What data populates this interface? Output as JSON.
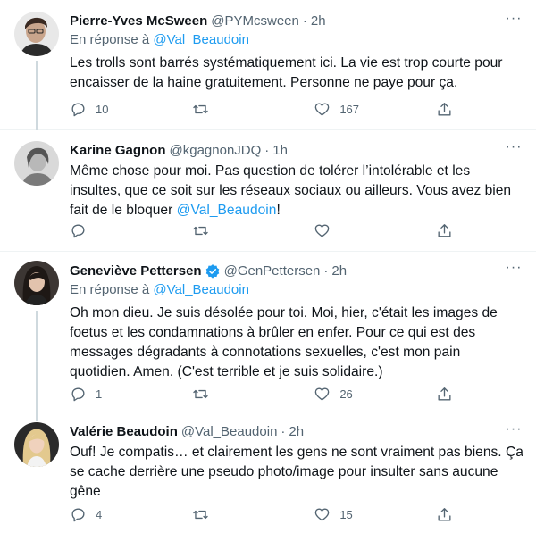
{
  "tweets": [
    {
      "name": "Pierre-Yves McSween",
      "handle": "@PYMcsween",
      "separator": "·",
      "time": "2h",
      "reply_prefix": "En réponse à",
      "reply_handle": "@Val_Beaudoin",
      "text": "Les trolls sont barrés systématiquement ici. La vie est trop courte pour encaisser de la haine gratuitement. Personne ne paye pour ça.",
      "replies": "10",
      "retweets": "",
      "likes": "167",
      "more": "···"
    },
    {
      "name": "Karine Gagnon",
      "handle": "@kgagnonJDQ",
      "separator": "·",
      "time": "1h",
      "text_before": "Même chose pour moi. Pas question de tolérer l’intolérable et les insultes, que ce soit sur les réseaux sociaux ou ailleurs. Vous avez bien fait de le bloquer ",
      "text_mention": "@Val_Beaudoin",
      "text_after": "!",
      "replies": "",
      "retweets": "",
      "likes": "",
      "more": "···"
    },
    {
      "name": "Geneviève Pettersen",
      "handle": "@GenPettersen",
      "separator": "·",
      "time": "2h",
      "reply_prefix": "En réponse à",
      "reply_handle": "@Val_Beaudoin",
      "text": "Oh mon dieu. Je suis désolée pour toi. Moi, hier, c'était les images de foetus et les condamnations à brûler en enfer. Pour ce qui est des messages dégradants à connotations sexuelles, c'est mon pain quotidien. Amen. (C'est terrible et je suis solidaire.)",
      "replies": "1",
      "retweets": "",
      "likes": "26",
      "more": "···"
    },
    {
      "name": "Valérie Beaudoin",
      "handle": "@Val_Beaudoin",
      "separator": "·",
      "time": "2h",
      "text": "Ouf! Je compatis… et clairement les gens ne sont vraiment pas biens. Ça se cache derrière une pseudo photo/image pour insulter sans aucune gêne",
      "replies": "4",
      "retweets": "",
      "likes": "15",
      "more": "···"
    }
  ],
  "colors": {
    "link": "#1d9bf0",
    "muted": "#536471",
    "verified": "#1d9bf0",
    "divider": "#eff3f4"
  },
  "icons": {
    "reply": "reply-icon",
    "retweet": "retweet-icon",
    "like": "like-icon",
    "share": "share-icon",
    "verified": "verified-badge-icon",
    "more": "more-options-icon"
  }
}
